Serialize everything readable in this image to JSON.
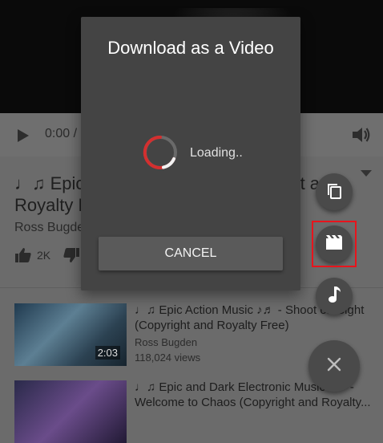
{
  "player": {
    "time": "0:00 /",
    "play_icon": "play-icon",
    "volume_icon": "volume-icon"
  },
  "video": {
    "title_line1": "♩♫ Epic T",
    "title_line1_tail": "t a",
    "title_line2": "Royalty F",
    "channel": "Ross Bugde",
    "like_count": "2K"
  },
  "related": [
    {
      "title": "♩♫ Epic Action Music ♪♬ - Shoot on Sight (Copyright and Royalty Free)",
      "channel": "Ross Bugden",
      "views": "118,024 views",
      "duration": "2:03"
    },
    {
      "title": "♩♫ Epic and Dark Electronic Music ♪♬ - Welcome to Chaos (Copyright and Royalty...",
      "channel": "",
      "views": "",
      "duration": ""
    }
  ],
  "dialog": {
    "title": "Download as a Video",
    "loading_text": "Loading..",
    "cancel_label": "CANCEL"
  },
  "fab_menu": {
    "items": [
      "copy-icon",
      "video-icon",
      "music-icon"
    ],
    "close_icon": "close-icon"
  },
  "colors": {
    "highlight": "#e8141c",
    "spinner": "#d32f2f"
  }
}
